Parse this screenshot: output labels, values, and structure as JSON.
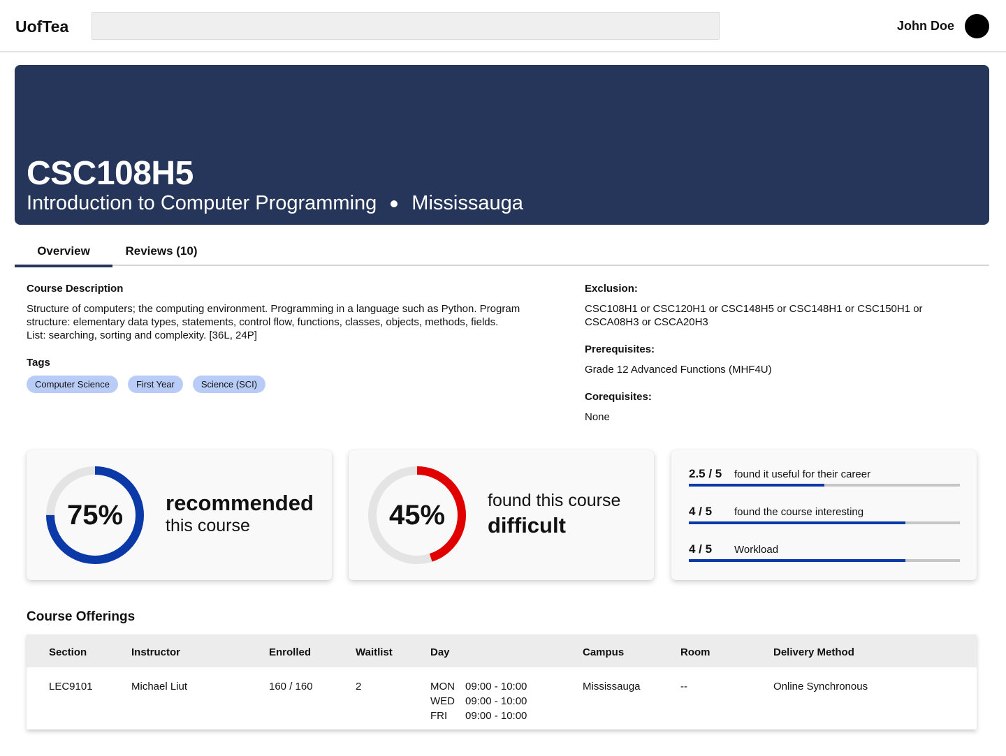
{
  "header": {
    "logo": "UofTea",
    "search_placeholder": "",
    "user_name": "John Doe"
  },
  "banner": {
    "code": "CSC108H5",
    "title": "Introduction to Computer Programming",
    "campus": "Mississauga",
    "background_color": "#26365a"
  },
  "tabs": [
    {
      "label": "Overview",
      "active": true
    },
    {
      "label": "Reviews (10)",
      "active": false
    }
  ],
  "overview": {
    "description_label": "Course Description",
    "description_lines": [
      "Structure of computers; the computing environment. Programming in a language such as Python. Program",
      "structure: elementary data types, statements, control flow, functions, classes, objects, methods, fields.",
      "List: searching, sorting and complexity. [36L, 24P]"
    ],
    "tags_label": "Tags",
    "tags": [
      "Computer Science",
      "First Year",
      "Science (SCI)"
    ],
    "exclusion_label": "Exclusion:",
    "exclusion_lines": [
      "CSC108H1 or CSC120H1 or CSC148H5 or CSC148H1 or CSC150H1 or",
      "CSCA08H3 or CSCA20H3"
    ],
    "prerequisites_label": "Prerequisites:",
    "prerequisites": "Grade 12 Advanced Functions (MHF4U)",
    "corequisites_label": "Corequisites:",
    "corequisites": "None"
  },
  "stats": {
    "recommended": {
      "percent": 75,
      "label": "75%",
      "big": "recommended",
      "small": "this course",
      "color": "#0b3aa8"
    },
    "difficult": {
      "percent": 45,
      "label": "45%",
      "small": "found this course",
      "big": "difficult",
      "color": "#e00000"
    },
    "metrics": [
      {
        "score_label": "2.5 / 5",
        "value": 2.5,
        "max": 5,
        "text": "found it useful for their career"
      },
      {
        "score_label": "4 / 5",
        "value": 4,
        "max": 5,
        "text": "found the course interesting"
      },
      {
        "score_label": "4 / 5",
        "value": 4,
        "max": 5,
        "text": "Workload"
      }
    ],
    "ring_track_color": "#e4e4e4",
    "bar_color": "#0b3aa8"
  },
  "offerings": {
    "title": "Course Offerings",
    "columns": [
      "Section",
      "Instructor",
      "Enrolled",
      "Waitlist",
      "Day",
      "Campus",
      "Room",
      "Delivery Method"
    ],
    "rows": [
      {
        "section": "LEC9101",
        "instructor": "Michael Liut",
        "enrolled": "160 / 160",
        "waitlist": "2",
        "days": [
          {
            "day": "MON",
            "time": "09:00 - 10:00"
          },
          {
            "day": "WED",
            "time": "09:00 - 10:00"
          },
          {
            "day": "FRI",
            "time": "09:00 - 10:00"
          }
        ],
        "campus": "Mississauga",
        "room": "--",
        "delivery": "Online Synchronous"
      }
    ]
  }
}
